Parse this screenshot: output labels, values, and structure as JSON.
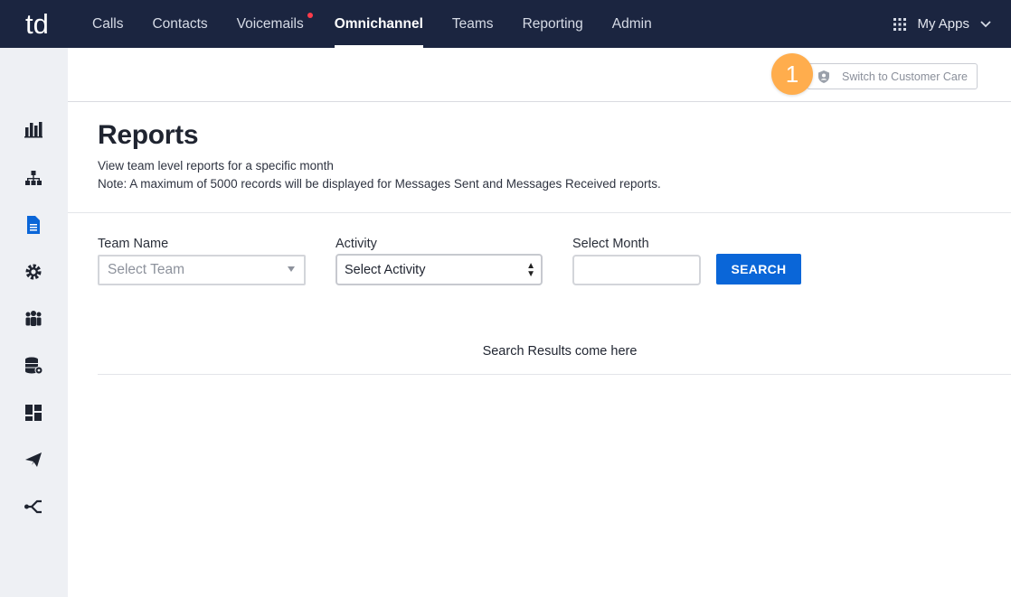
{
  "nav": {
    "logo_text": "td",
    "items": [
      {
        "label": "Calls"
      },
      {
        "label": "Contacts"
      },
      {
        "label": "Voicemails"
      },
      {
        "label": "Omnichannel"
      },
      {
        "label": "Teams"
      },
      {
        "label": "Reporting"
      },
      {
        "label": "Admin"
      }
    ],
    "active": "Omnichannel",
    "myapps_label": "My Apps"
  },
  "sidebar": {
    "items": [
      "bar-chart",
      "org-hierarchy",
      "document",
      "settings-gear",
      "people-group",
      "database-settings",
      "dashboard-layout",
      "send-paper-plane",
      "share-branch"
    ],
    "active": "document"
  },
  "header": {
    "switch_button_label": "Switch to Customer Care",
    "step_badge": "1"
  },
  "page": {
    "title": "Reports",
    "subtitle": "View team level reports for a specific month",
    "note": "Note: A maximum of 5000 records will be displayed for Messages Sent and Messages Received reports."
  },
  "filters": {
    "team_label": "Team Name",
    "team_placeholder": "Select Team",
    "activity_label": "Activity",
    "activity_value": "Select Activity",
    "month_label": "Select Month",
    "month_value": "",
    "search_label": "SEARCH"
  },
  "results": {
    "placeholder_text": "Search Results come here"
  },
  "colors": {
    "topbar": "#1b2540",
    "accent": "#0a66d8",
    "badge": "#ffad4d",
    "notification": "#ff3b4a",
    "sidebar_bg": "#eef0f4"
  }
}
